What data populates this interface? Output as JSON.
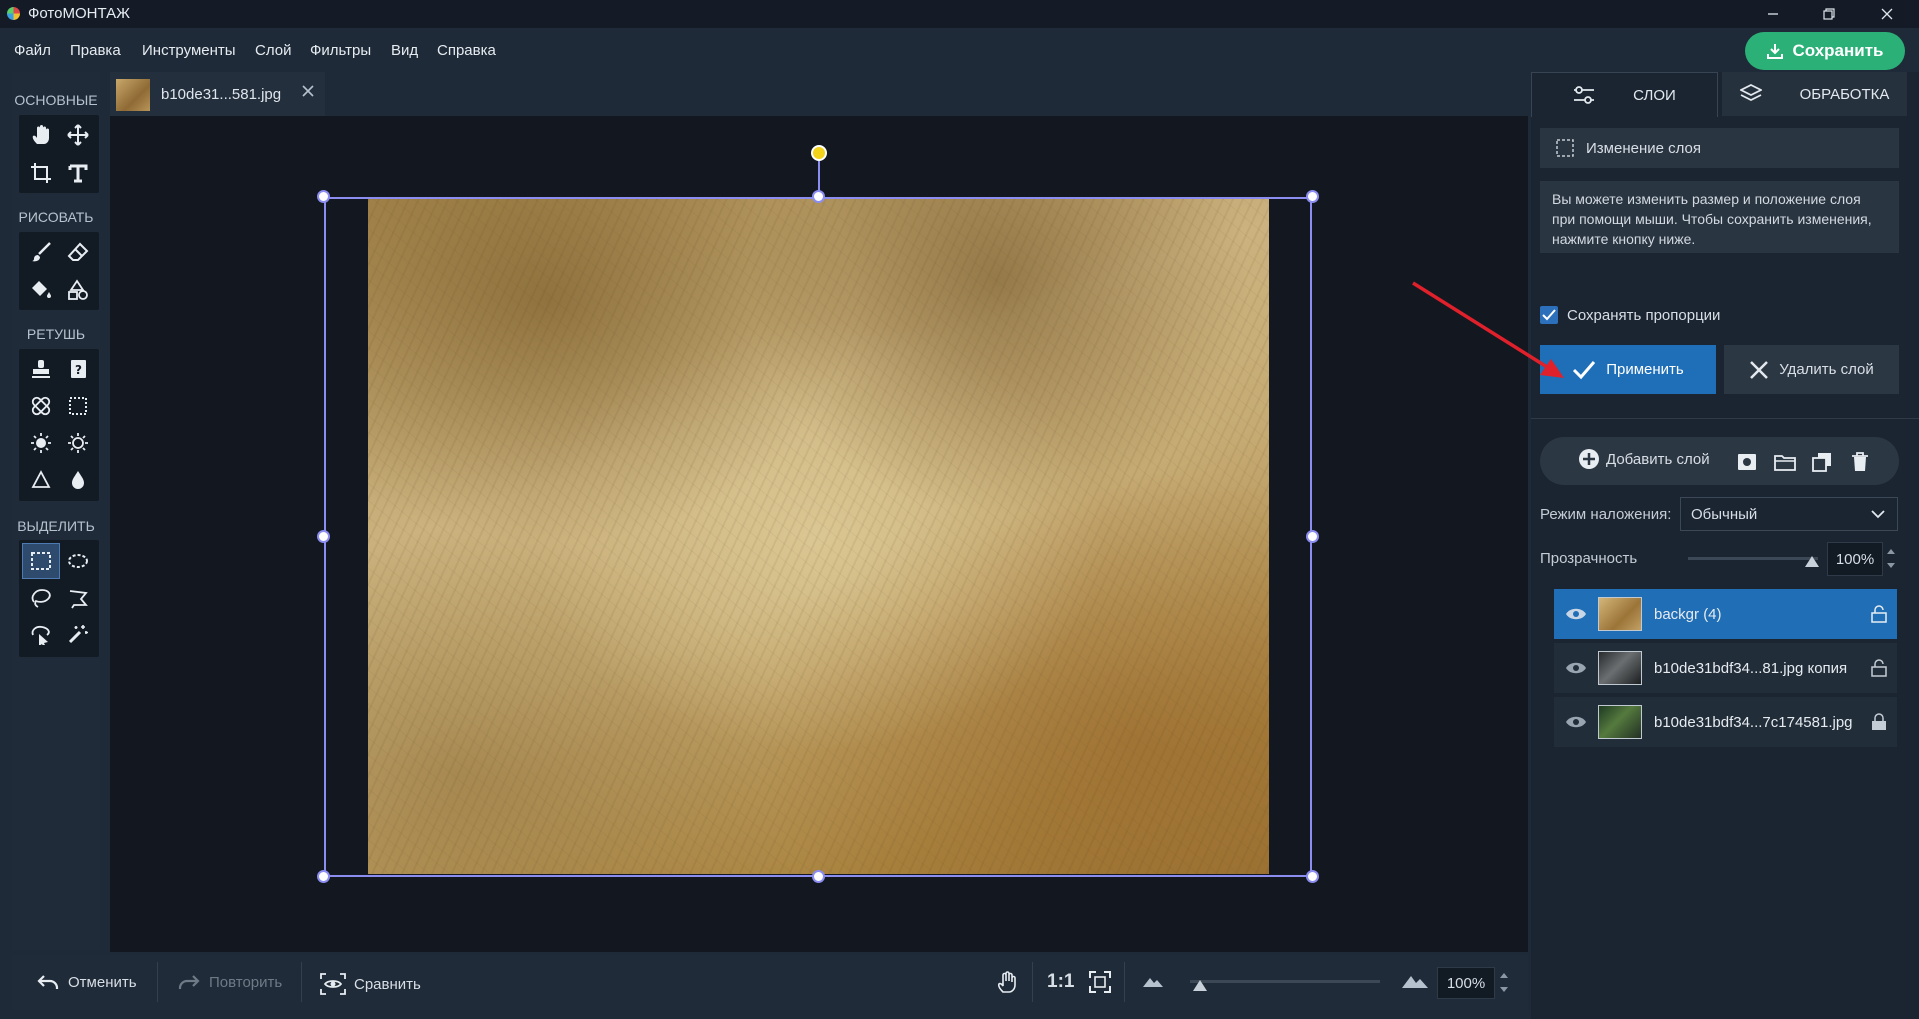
{
  "window": {
    "title": "ФотоМОНТАЖ",
    "controls": [
      "minimize-icon",
      "restore-icon",
      "close-icon"
    ]
  },
  "menu": {
    "items": [
      "Файл",
      "Правка",
      "Инструменты",
      "Слой",
      "Фильтры",
      "Вид",
      "Справка"
    ],
    "save_label": "Сохранить"
  },
  "tools": {
    "sections": [
      {
        "label": "ОСНОВНЫЕ",
        "tools": [
          "hand-icon",
          "move-icon",
          "crop-icon",
          "text-icon"
        ]
      },
      {
        "label": "РИСОВАТЬ",
        "tools": [
          "brush-icon",
          "eraser-icon",
          "fill-icon",
          "shapes-icon"
        ]
      },
      {
        "label": "РЕТУШЬ",
        "tools": [
          "stamp-icon",
          "healing-icon",
          "patch-icon",
          "frame-icon",
          "dodge-icon",
          "burn-icon",
          "sharpen-icon",
          "blur-icon"
        ]
      },
      {
        "label": "ВЫДЕЛИТЬ",
        "tools": [
          "rect-select-icon",
          "ellipse-select-icon",
          "lasso-icon",
          "polygon-lasso-icon",
          "magnetic-lasso-icon",
          "magic-wand-icon"
        ]
      }
    ],
    "active": "rect-select-icon"
  },
  "document": {
    "tab_label": "b10de31...581.jpg"
  },
  "bottom": {
    "undo": "Отменить",
    "redo": "Повторить",
    "compare": "Сравнить",
    "one_to_one": "1:1",
    "zoom": "100%",
    "zoom_level": 0.05
  },
  "right_panel": {
    "tabs": [
      "СЛОИ",
      "ОБРАБОТКА"
    ],
    "active_tab": "СЛОИ",
    "edit_header": "Изменение слоя",
    "info": "Вы можете изменить размер и положение слоя при помощи мыши. Чтобы сохранить изменения, нажмите кнопку ниже.",
    "keep_proportions": "Сохранять пропорции",
    "keep_proportions_checked": true,
    "apply": "Применить",
    "delete": "Удалить слой",
    "add_layer": "Добавить слой",
    "blend_label": "Режим наложения:",
    "blend_value": "Обычный",
    "opacity_label": "Прозрачность",
    "opacity_value": "100%",
    "opacity_level": 1.0,
    "layers": [
      {
        "name": "backgr (4)",
        "selected": true,
        "locked": false
      },
      {
        "name": "b10de31bdf34...81.jpg копия",
        "selected": false,
        "locked": false
      },
      {
        "name": "b10de31bdf34...7c174581.jpg",
        "selected": false,
        "locked": true
      }
    ]
  },
  "colors": {
    "accent_green": "#2bb077",
    "accent_blue": "#1e6fb8",
    "selection_outline": "#8c8df0",
    "rotate_handle": "#f3d21b",
    "annotation_arrow": "#e0202a"
  }
}
